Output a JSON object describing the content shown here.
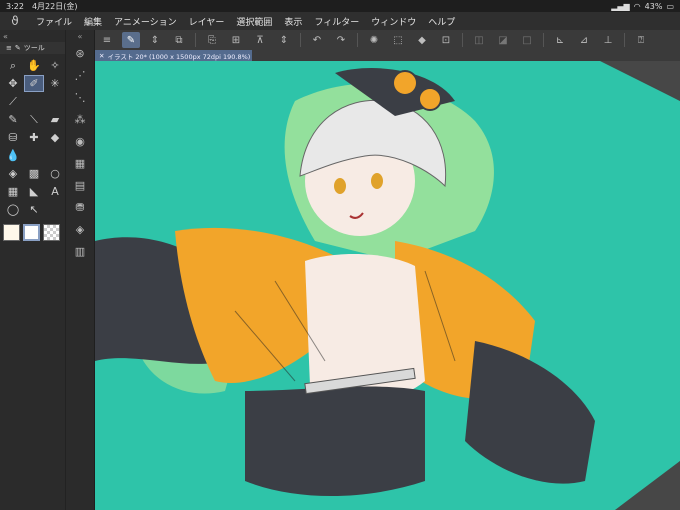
{
  "status": {
    "time": "3:22",
    "date": "4月22日(金)",
    "battery": "43%"
  },
  "menu": [
    "ファイル",
    "編集",
    "アニメーション",
    "レイヤー",
    "選択範囲",
    "表示",
    "フィルター",
    "ウィンドウ",
    "ヘルプ"
  ],
  "tool_panel": {
    "tab_label": "ツール"
  },
  "document": {
    "tab_title": "イラスト 20* (1000 x 1500px 72dpi 190.8%)"
  },
  "toolbar_icons": [
    "menu-icon",
    "edit-icon",
    "chevron-updown-icon",
    "screen-icon",
    "new-icon",
    "open-icon",
    "save-icon",
    "chevron-updown-icon",
    "undo-icon",
    "redo-icon",
    "loading-icon",
    "clear-icon",
    "fill-icon",
    "transform-icon",
    "disabled-icon",
    "disabled-icon",
    "disabled-icon",
    "pen-check-icon",
    "brush-icon",
    "ruler-icon",
    "help-icon"
  ],
  "tools_icons": [
    "zoom-icon",
    "hand-icon",
    "rotate-icon",
    "move-icon",
    "pen-icon",
    "sparkle-icon",
    "eyedropper-icon",
    "",
    "",
    "pencil-icon",
    "brush-icon",
    "marker-icon",
    "airbrush-icon",
    "blend-icon",
    "eraser-icon",
    "water-icon",
    "",
    "",
    "fill-icon",
    "gradient-icon",
    "ellipse-icon",
    "frame-icon",
    "ruler-icon",
    "text-icon",
    "lasso-icon",
    "select-icon",
    ""
  ],
  "colors": {
    "teal": "#2ec4a9",
    "jacket": "#f2a52a",
    "dark": "#3b3e45",
    "canvas_gray": "#474747"
  }
}
